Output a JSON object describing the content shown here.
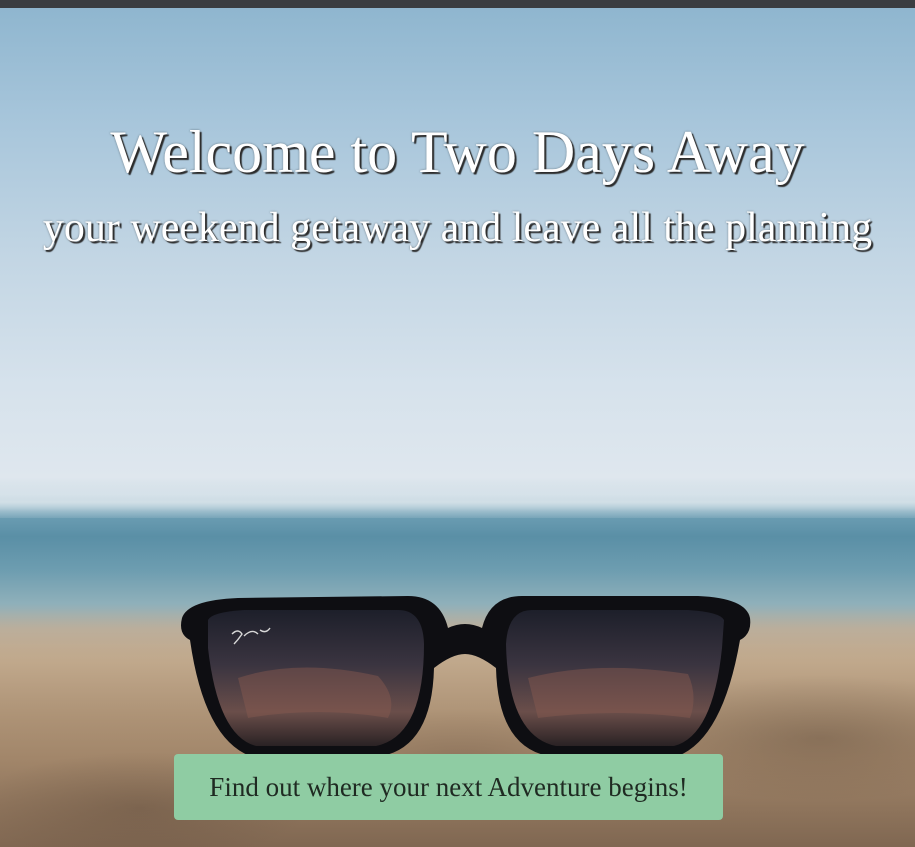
{
  "hero": {
    "title": "Welcome to Two Days Away",
    "subtitle": "your weekend getaway and leave all the planning",
    "image_subject": "sunglasses-on-beach"
  },
  "cta": {
    "label": "Find out where your next Adventure begins!"
  },
  "colors": {
    "topbar": "#3a3d41",
    "cta_background": "#8fcca3",
    "cta_text": "#1f2a22",
    "heading_text": "#ffffff"
  }
}
